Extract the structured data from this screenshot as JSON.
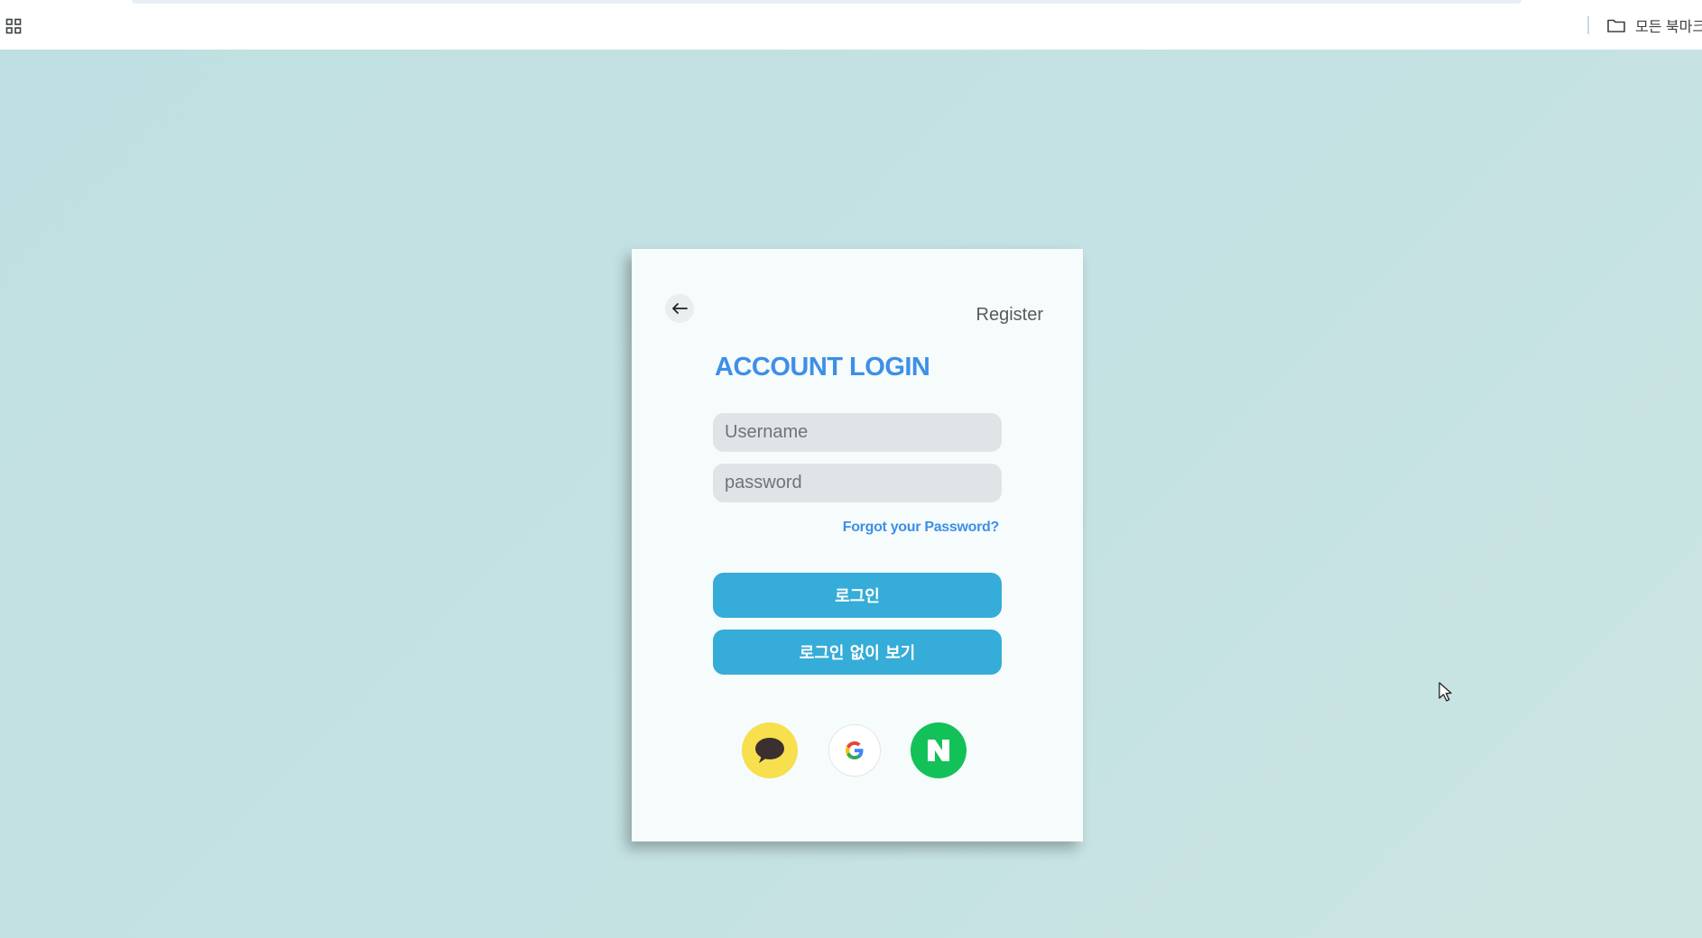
{
  "browser": {
    "bookmarks_label": "모든 북마크",
    "icons": [
      "apps-grid-icon",
      "folder-icon"
    ]
  },
  "login": {
    "register_label": "Register",
    "title": "ACCOUNT LOGIN",
    "username_placeholder": "Username",
    "password_placeholder": "password",
    "forgot_label": "Forgot your Password?",
    "login_button_label": "로그인",
    "guest_button_label": "로그인 없이 보기",
    "social_buttons": [
      "kakao-login",
      "google-login",
      "naver-login"
    ]
  },
  "colors": {
    "accent_blue": "#3d8fe8",
    "button_blue": "#36acd8",
    "background": "#c0dfe2",
    "kakao": "#f7df4d",
    "naver": "#13c159"
  }
}
